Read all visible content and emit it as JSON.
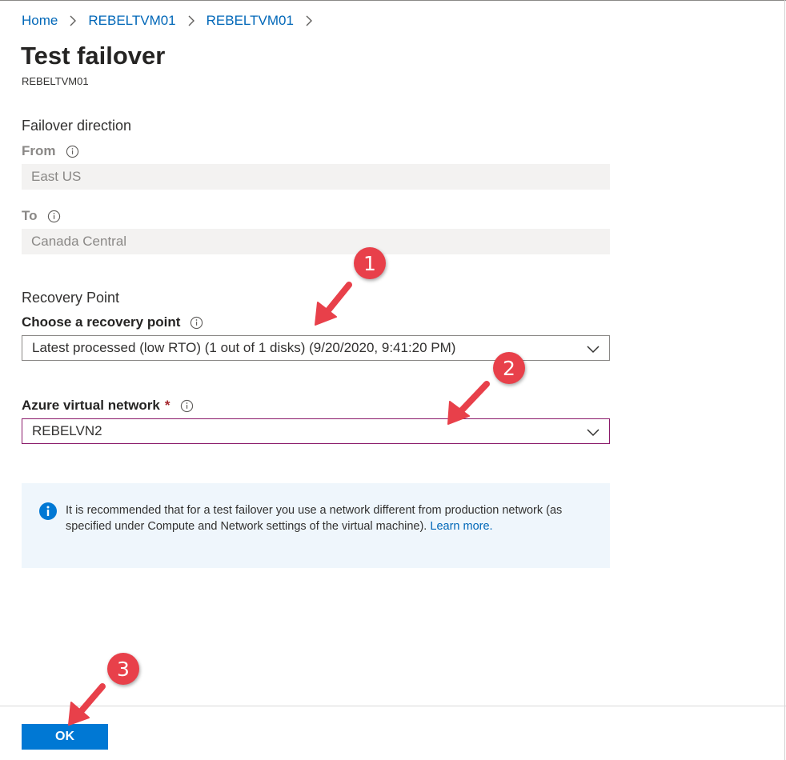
{
  "breadcrumb": [
    {
      "label": "Home"
    },
    {
      "label": "REBELTVM01"
    },
    {
      "label": "REBELTVM01"
    }
  ],
  "page": {
    "title": "Test failover",
    "subtitle": "REBELTVM01"
  },
  "failover": {
    "section_label": "Failover direction",
    "from_label": "From",
    "from_value": "East US",
    "to_label": "To",
    "to_value": "Canada Central"
  },
  "recovery": {
    "section_label": "Recovery Point",
    "choose_label": "Choose a recovery point",
    "selected": "Latest processed (low RTO) (1 out of 1 disks) (9/20/2020, 9:41:20 PM)"
  },
  "network": {
    "label": "Azure virtual network",
    "required_marker": "*",
    "selected": "REBELVN2"
  },
  "infobox": {
    "text": "It is recommended that for a test failover you use a network different from production network (as specified under Compute and Network settings of the virtual machine).",
    "link_text": "Learn more."
  },
  "footer": {
    "ok_label": "OK"
  },
  "annotations": {
    "badge1": "1",
    "badge2": "2",
    "badge3": "3"
  },
  "colors": {
    "link": "#0067b8",
    "primary_button": "#0078d4",
    "annotation_red": "#e8404a",
    "info_bg": "#eff6fc"
  }
}
